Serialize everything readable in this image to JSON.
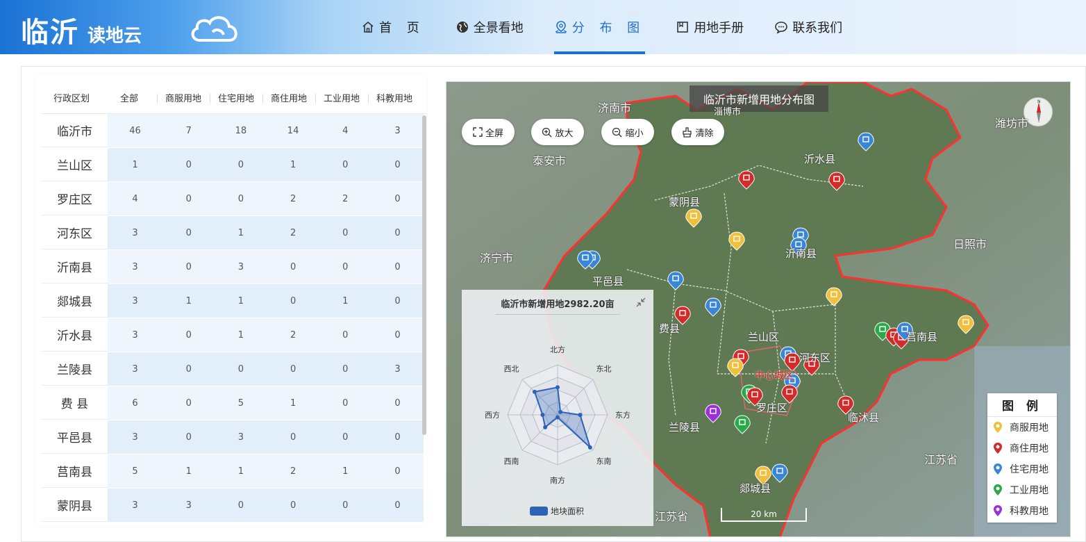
{
  "header": {
    "logo_main": "临沂",
    "logo_sub": "读地云",
    "nav": [
      {
        "label": "首 页",
        "icon": "home-icon"
      },
      {
        "label": "全景看地",
        "icon": "globe-icon"
      },
      {
        "label": "分 布 图",
        "icon": "map-pin-icon",
        "active": true
      },
      {
        "label": "用地手册",
        "icon": "book-icon"
      },
      {
        "label": "联系我们",
        "icon": "chat-icon"
      }
    ]
  },
  "table": {
    "headers": [
      "行政区划",
      "全部",
      "商服用地",
      "住宅用地",
      "商住用地",
      "工业用地",
      "科教用地"
    ],
    "rows": [
      {
        "region": "临沂市",
        "values": [
          "46",
          "7",
          "18",
          "14",
          "4",
          "3"
        ]
      },
      {
        "region": "兰山区",
        "values": [
          "1",
          "0",
          "0",
          "1",
          "0",
          "0"
        ]
      },
      {
        "region": "罗庄区",
        "values": [
          "4",
          "0",
          "0",
          "2",
          "2",
          "0"
        ]
      },
      {
        "region": "河东区",
        "values": [
          "3",
          "0",
          "1",
          "2",
          "0",
          "0"
        ]
      },
      {
        "region": "沂南县",
        "values": [
          "3",
          "0",
          "3",
          "0",
          "0",
          "0"
        ]
      },
      {
        "region": "郯城县",
        "values": [
          "3",
          "1",
          "1",
          "0",
          "1",
          "0"
        ]
      },
      {
        "region": "沂水县",
        "values": [
          "3",
          "0",
          "1",
          "2",
          "0",
          "0"
        ]
      },
      {
        "region": "兰陵县",
        "values": [
          "3",
          "0",
          "0",
          "0",
          "0",
          "3"
        ]
      },
      {
        "region": "费 县",
        "values": [
          "6",
          "0",
          "5",
          "1",
          "0",
          "0"
        ]
      },
      {
        "region": "平邑县",
        "values": [
          "3",
          "0",
          "3",
          "0",
          "0",
          "0"
        ]
      },
      {
        "region": "莒南县",
        "values": [
          "5",
          "1",
          "1",
          "2",
          "1",
          "0"
        ]
      },
      {
        "region": "蒙阴县",
        "values": [
          "3",
          "3",
          "0",
          "0",
          "0",
          "0"
        ]
      }
    ]
  },
  "map": {
    "title": "临沂市新增用地分布图",
    "buttons": {
      "fullscreen": "全屏",
      "zoom_in": "放大",
      "zoom_out": "缩小",
      "clear": "清除"
    },
    "labels": {
      "jinan": "济南市",
      "zibo": "淄博市",
      "weifang": "潍坊市",
      "taian": "泰安市",
      "jining": "济宁市",
      "rizhao": "日照市",
      "jiangsu1": "江苏省",
      "jiangsu2": "江苏省",
      "yishui": "沂水县",
      "mengyin": "蒙阴县",
      "yinan": "沂南县",
      "pingyi": "平邑县",
      "fei": "费县",
      "lanshan": "兰山区",
      "hedong": "河东区",
      "center": "中心城区",
      "luozhuang": "罗庄区",
      "lanling": "兰陵县",
      "tancheng": "郯城县",
      "junan": "莒南县",
      "linshu": "临沭县"
    },
    "scale": "20 km",
    "colors": {
      "commercial": "#f0c03c",
      "mixed": "#d42a2a",
      "residential": "#3a86d6",
      "industrial": "#2aa84a",
      "education": "#9b2fd8"
    }
  },
  "radar": {
    "title": "临沂市新增用地2982.20亩",
    "axes": [
      "北方",
      "东北",
      "东方",
      "东南",
      "南方",
      "西南",
      "西方",
      "西北"
    ],
    "values": [
      0.55,
      0.08,
      0.45,
      0.92,
      0.05,
      0.35,
      0.3,
      0.65
    ],
    "legend": "地块面积"
  },
  "legend": {
    "title": "图 例",
    "items": [
      {
        "label": "商服用地",
        "color": "#f0c03c"
      },
      {
        "label": "商住用地",
        "color": "#d42a2a"
      },
      {
        "label": "住宅用地",
        "color": "#3a86d6"
      },
      {
        "label": "工业用地",
        "color": "#2aa84a"
      },
      {
        "label": "科教用地",
        "color": "#9b2fd8"
      }
    ]
  }
}
